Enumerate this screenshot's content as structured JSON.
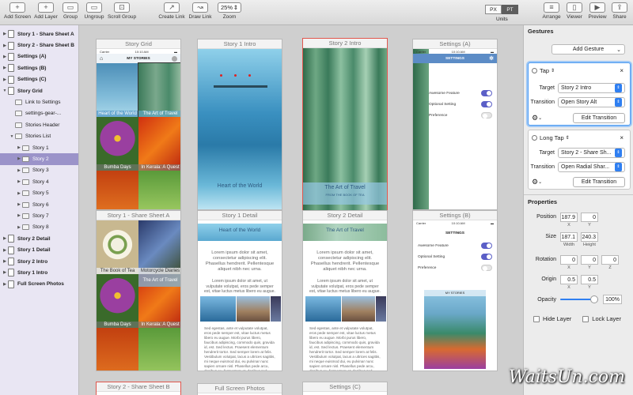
{
  "toolbar": {
    "add_screen": "Add Screen",
    "add_layer": "Add Layer",
    "group": "Group",
    "ungroup": "Ungroup",
    "scroll_group": "Scroll Group",
    "create_link": "Create Link",
    "draw_link": "Draw Link",
    "zoom_value": "25%",
    "zoom_label": "Zoom",
    "unit_px": "PX",
    "unit_pt": "PT",
    "units_label": "Units",
    "arrange": "Arrange",
    "viewer": "Viewer",
    "preview": "Preview",
    "share": "Share"
  },
  "layers": [
    {
      "label": "Story 1 - Share Sheet A",
      "indent": 0,
      "bold": true,
      "type": "screen",
      "arrow": "▶"
    },
    {
      "label": "Story 2 - Share Sheet B",
      "indent": 0,
      "bold": true,
      "type": "screen",
      "arrow": "▶"
    },
    {
      "label": "Settings (A)",
      "indent": 0,
      "bold": true,
      "type": "screen",
      "arrow": "▶"
    },
    {
      "label": "Settings (B)",
      "indent": 0,
      "bold": true,
      "type": "screen",
      "arrow": "▶"
    },
    {
      "label": "Settings (C)",
      "indent": 0,
      "bold": true,
      "type": "screen",
      "arrow": "▶"
    },
    {
      "label": "Story Grid",
      "indent": 0,
      "bold": true,
      "type": "screen",
      "arrow": "▼"
    },
    {
      "label": "Link to Settings",
      "indent": 1,
      "bold": false,
      "type": "link",
      "arrow": ""
    },
    {
      "label": "settings-gear-...",
      "indent": 1,
      "bold": false,
      "type": "image",
      "arrow": ""
    },
    {
      "label": "Stories Header",
      "indent": 1,
      "bold": false,
      "type": "image",
      "arrow": ""
    },
    {
      "label": "Stories List",
      "indent": 1,
      "bold": false,
      "type": "group",
      "arrow": "▼"
    },
    {
      "label": "Story 1",
      "indent": 2,
      "bold": false,
      "type": "group",
      "arrow": "▶"
    },
    {
      "label": "Story 2",
      "indent": 2,
      "bold": false,
      "type": "group",
      "arrow": "▶",
      "selected": true
    },
    {
      "label": "Story 3",
      "indent": 2,
      "bold": false,
      "type": "group",
      "arrow": "▶"
    },
    {
      "label": "Story 4",
      "indent": 2,
      "bold": false,
      "type": "group",
      "arrow": "▶"
    },
    {
      "label": "Story 5",
      "indent": 2,
      "bold": false,
      "type": "group",
      "arrow": "▶"
    },
    {
      "label": "Story 6",
      "indent": 2,
      "bold": false,
      "type": "group",
      "arrow": "▶"
    },
    {
      "label": "Story 7",
      "indent": 2,
      "bold": false,
      "type": "group",
      "arrow": "▶"
    },
    {
      "label": "Story 8",
      "indent": 2,
      "bold": false,
      "type": "group",
      "arrow": "▶"
    },
    {
      "label": "Story 2 Detail",
      "indent": 0,
      "bold": true,
      "type": "screen",
      "arrow": "▶"
    },
    {
      "label": "Story 1 Detail",
      "indent": 0,
      "bold": true,
      "type": "screen",
      "arrow": "▶"
    },
    {
      "label": "Story 2 Intro",
      "indent": 0,
      "bold": true,
      "type": "screen",
      "arrow": "▶"
    },
    {
      "label": "Story 1 Intro",
      "indent": 0,
      "bold": true,
      "type": "screen",
      "arrow": "▶"
    },
    {
      "label": "Full Screen Photos",
      "indent": 0,
      "bold": true,
      "type": "screen",
      "arrow": "▶"
    }
  ],
  "screens": {
    "story_grid": {
      "title": "Story Grid",
      "header": "MY STORIES",
      "carrier": "Carrier",
      "time": "10:10 AM",
      "tiles": [
        "Heart of the World",
        "The Art of Travel",
        "Bumba Days",
        "In Kerala: A Quest"
      ]
    },
    "story1_intro": {
      "title": "Story 1 Intro",
      "caption": "Heart of the World"
    },
    "story2_intro": {
      "title": "Story 2 Intro",
      "caption": "The Art of Travel",
      "sub": "FROM THE BOOK OF TEA"
    },
    "settings_a": {
      "title": "Settings (A)",
      "carrier": "Carrier",
      "time": "10:10 AM",
      "header": "SETTINGS",
      "rows": [
        {
          "label": "Awesome Feature",
          "on": true
        },
        {
          "label": "Optional Setting",
          "on": true
        },
        {
          "label": "Preference",
          "on": false
        }
      ]
    },
    "story1_share": {
      "title": "Story 1 - Share Sheet A",
      "tiles": [
        "The Book of Tea",
        "Motorcycle Diaries",
        "Bumba Days",
        "In Kerala: A Quest",
        "The Art of Travel"
      ]
    },
    "story1_detail": {
      "title": "Story 1 Detail",
      "banner": "Heart of the World",
      "lead": "Lorem ipsum dolor sit amet, consectetur adipiscing elit. Phasellus hendrerit. Pellentesque aliquet nibh nec urna.",
      "para": "Lorem ipsum dolor sit amet, ut vulputate volutpat, eros pede semper est, vitae luctus metus libero eu augue.",
      "body": "Sed egestas, ante et vulputate volutpat, eros pede semper est, vitae luctus metus libero eu augue. Morbi purus libero, faucibus adipiscing, commodo quis, gravida id, est. Sed lectus. Praesent elementum hendrerit tortor. Sed semper lorem at felis. Vestibulum volutpat, lacus a ultrices sagittis, mi neque euismod dui, eu pulvinar nunc sapien ornare nisl. Phasellus pede arcu, dapibus eu, fermentum et, dapibus sed, urna."
    },
    "story2_detail": {
      "title": "Story 2 Detail",
      "banner": "The Art of Travel",
      "lead": "Lorem ipsum dolor sit amet, consectetur adipiscing elit. Phasellus hendrerit. Pellentesque aliquet nibh nec urna.",
      "para": "Lorem ipsum dolor sit amet, ut vulputate volutpat, eros pede semper est, vitae luctus metus libero eu augue.",
      "body": "Sed egestas, ante et vulputate volutpat, eros pede semper est, vitae luctus metus libero eu augue. Morbi purus libero, faucibus adipiscing, commodo quis, gravida id, est. Sed lectus. Praesent elementum hendrerit tortor. Sed semper lorem at felis. Vestibulum volutpat, lacus a ultrices sagittis, mi neque euismod dui, eu pulvinar nunc sapien ornare nisl. Phasellus pede arcu, dapibus eu, fermentum et, dapibus sed, urna."
    },
    "settings_b": {
      "title": "Settings (B)",
      "carrier": "Carrier",
      "time": "10:10 AM",
      "header": "SETTINGS",
      "rows": [
        {
          "label": "Awesome Feature",
          "on": true
        },
        {
          "label": "Optional Setting",
          "on": true
        },
        {
          "label": "Preference",
          "on": false
        }
      ],
      "mini_header": "MY STORIES"
    },
    "story2_share": {
      "title": "Story 2 - Share Sheet B"
    },
    "full_screen_photos": {
      "title": "Full Screen Photos"
    },
    "settings_c": {
      "title": "Settings (C)"
    }
  },
  "inspector": {
    "gestures_heading": "Gestures",
    "add_gesture": "Add Gesture",
    "gesture1": {
      "type": "Tap",
      "target_label": "Target",
      "target": "Story 2 Intro",
      "transition_label": "Transition",
      "transition": "Open Story Alt",
      "edit": "Edit Transition"
    },
    "gesture2": {
      "type": "Long Tap",
      "target_label": "Target",
      "target": "Story 2 - Share Sh...",
      "transition_label": "Transition",
      "transition": "Open Radial Shar...",
      "edit": "Edit Transition"
    },
    "properties_heading": "Properties",
    "position_label": "Position",
    "position_x": "187.9",
    "position_y": "0",
    "size_label": "Size",
    "size_w": "187.1",
    "size_h": "240.3",
    "width_label": "Width",
    "height_label": "Height",
    "x_label": "X",
    "y_label": "Y",
    "z_label": "Z",
    "rotation_label": "Rotation",
    "rot_x": "0",
    "rot_y": "0",
    "rot_z": "0",
    "origin_label": "Origin",
    "origin_x": "0.5",
    "origin_y": "0.5",
    "opacity_label": "Opacity",
    "opacity_value": "100%",
    "opacity_level": 1.0,
    "hide_layer": "Hide Layer",
    "lock_layer": "Lock Layer"
  },
  "watermark": "WaitsUn.com",
  "colors": {
    "selection": "#9b93c9",
    "accent": "#2f7ff1",
    "selected_screen_border": "#e0574e",
    "toggle_on": "#5b5fc7"
  }
}
